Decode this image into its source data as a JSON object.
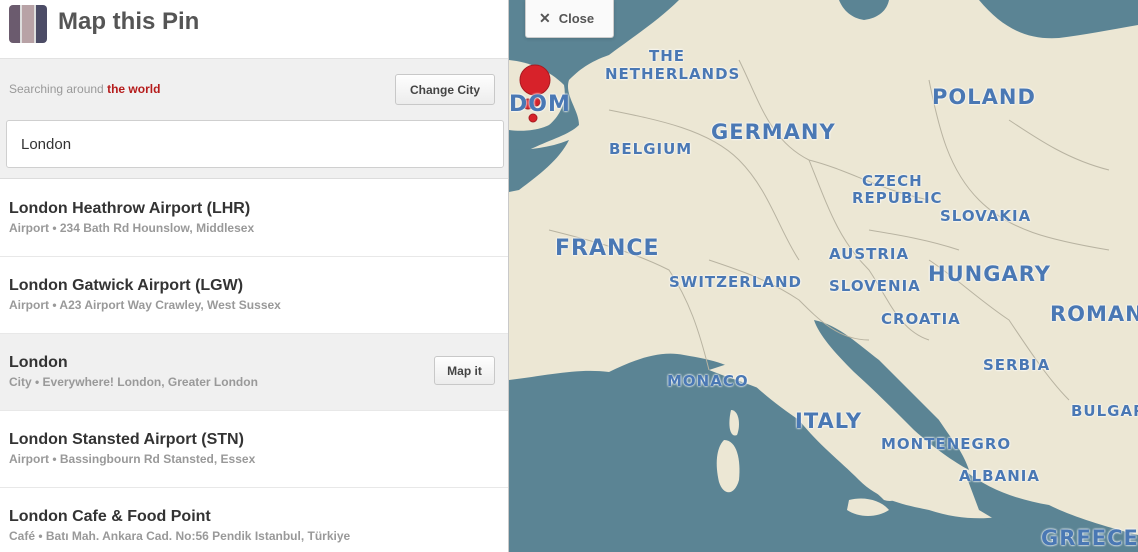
{
  "header": {
    "title": "Map this Pin",
    "thumbnail_icon": "pin-thumbnail"
  },
  "search": {
    "searching_prefix": "Searching around",
    "searching_location": "the world",
    "change_city_label": "Change City",
    "query_value": "London"
  },
  "results": [
    {
      "name": "London Heathrow Airport (LHR)",
      "subtitle": "Airport • 234 Bath Rd Hounslow, Middlesex"
    },
    {
      "name": "London Gatwick Airport (LGW)",
      "subtitle": "Airport • A23 Airport Way Crawley, West Sussex"
    },
    {
      "name": "London",
      "subtitle": "City • Everywhere! London, Greater London",
      "action_label": "Map it"
    },
    {
      "name": "London Stansted Airport (STN)",
      "subtitle": "Airport • Bassingbourn Rd Stansted, Essex"
    },
    {
      "name": "London Cafe & Food Point",
      "subtitle": "Café • Batı Mah. Ankara Cad. No:56 Pendik Istanbul, Türkiye"
    }
  ],
  "map": {
    "close_label": "Close",
    "countries": {
      "netherlands_1": "THE",
      "netherlands_2": "NETHERLANDS",
      "uk_fragment": "DOM",
      "belgium": "BELGIUM",
      "germany": "GERMANY",
      "poland": "POLAND",
      "czech_1": "CZECH",
      "czech_2": "REPUBLIC",
      "slovakia": "SLOVAKIA",
      "france": "FRANCE",
      "austria": "AUSTRIA",
      "hungary": "HUNGARY",
      "switzerland": "SWITZERLAND",
      "slovenia": "SLOVENIA",
      "croatia": "CROATIA",
      "romania": "ROMAN",
      "serbia": "SERBIA",
      "monaco": "MONACO",
      "italy": "ITALY",
      "bulgaria": "BULGAR",
      "montenegro": "MONTENEGRO",
      "albania": "ALBANIA",
      "greece": "GREECE"
    },
    "colors": {
      "land": "#ece7d4",
      "sea": "#5b8494",
      "label": "#4a78b4",
      "pin": "#d7222a"
    }
  }
}
